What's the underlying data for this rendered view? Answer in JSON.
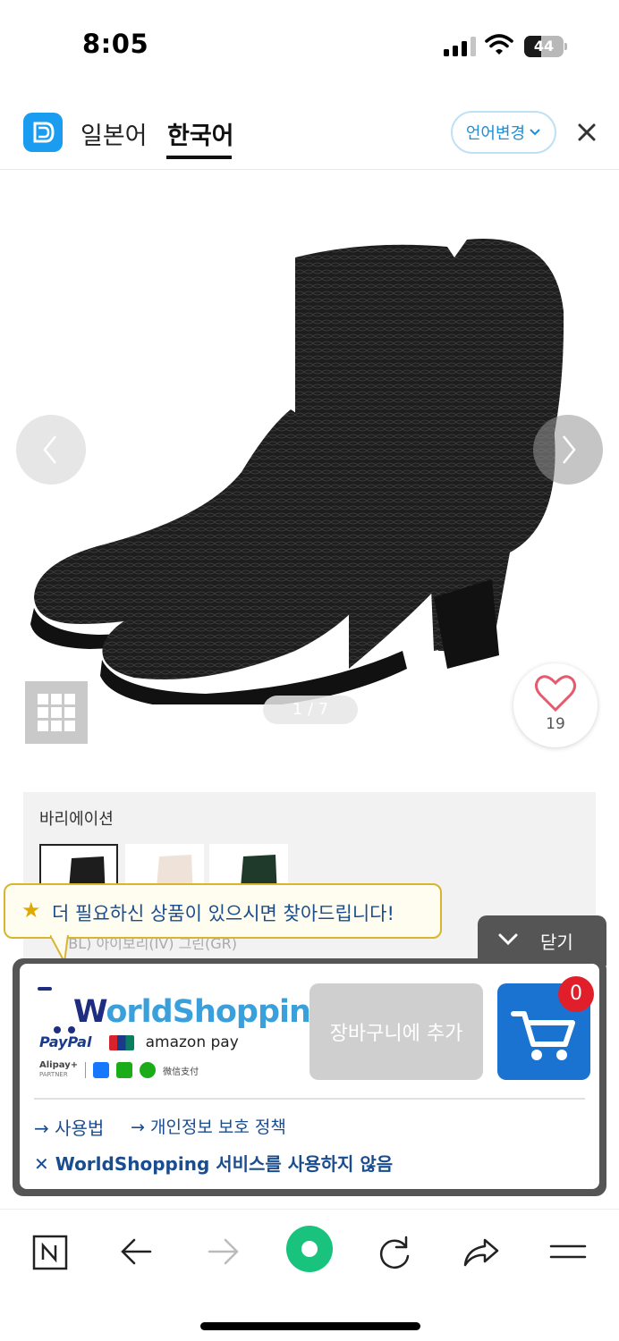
{
  "status_bar": {
    "time": "8:05",
    "battery_level": "44"
  },
  "header": {
    "tabs": [
      {
        "label": "일본어",
        "active": false
      },
      {
        "label": "한국어",
        "active": true
      }
    ],
    "language_change_label": "언어변경"
  },
  "product": {
    "page_indicator": "1 / 7",
    "favorite_count": "19"
  },
  "variation": {
    "title": "바리에이션",
    "partial_labels": "(BL)     아이보리(IV)  그린(GR)"
  },
  "tooltip": {
    "text": "더 필요하신 상품이 있으시면 찾아드립니다!"
  },
  "close_tab": {
    "label": "닫기"
  },
  "worldshopping": {
    "logo_text_w": "W",
    "logo_text_rest": "orldShopping",
    "paypal": "PayPal",
    "amazonpay": "amazon pay",
    "alipay": "Alipay+",
    "alipay_sub": "PARTNER",
    "wechat": "微信支付",
    "add_to_cart_label": "장바구니에 추가",
    "cart_count": "0",
    "links": {
      "howto": "→ 사용법",
      "privacy": "→ 개인정보 보호 정책",
      "optout": "✕ WorldShopping 서비스를 사용하지 않음"
    }
  },
  "colors": {
    "accent_blue": "#1a73d0",
    "link_blue": "#1a4d8f",
    "badge_red": "#e01f2a",
    "tooltip_border": "#d8b531",
    "browser_green": "#19c37d"
  }
}
